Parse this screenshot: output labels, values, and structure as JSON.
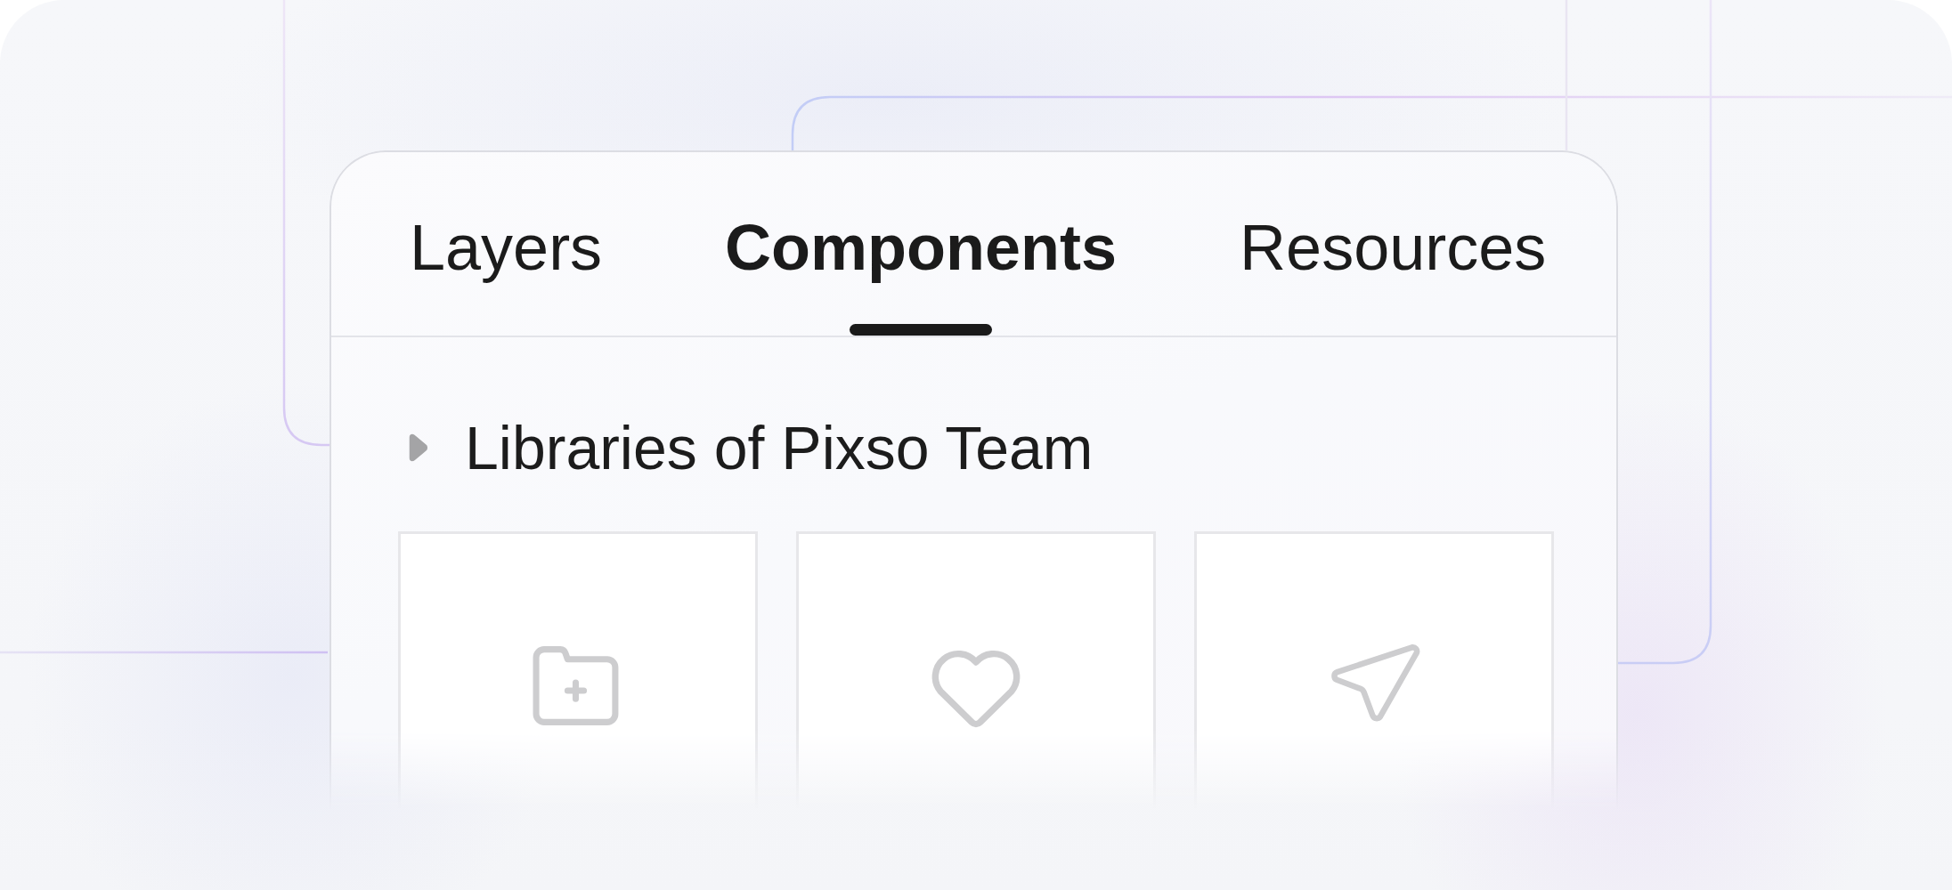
{
  "tabs": [
    {
      "label": "Layers",
      "selected": false
    },
    {
      "label": "Components",
      "selected": true
    },
    {
      "label": "Resources",
      "selected": false
    }
  ],
  "library": {
    "title": "Libraries of Pixso Team",
    "expanded": false
  }
}
